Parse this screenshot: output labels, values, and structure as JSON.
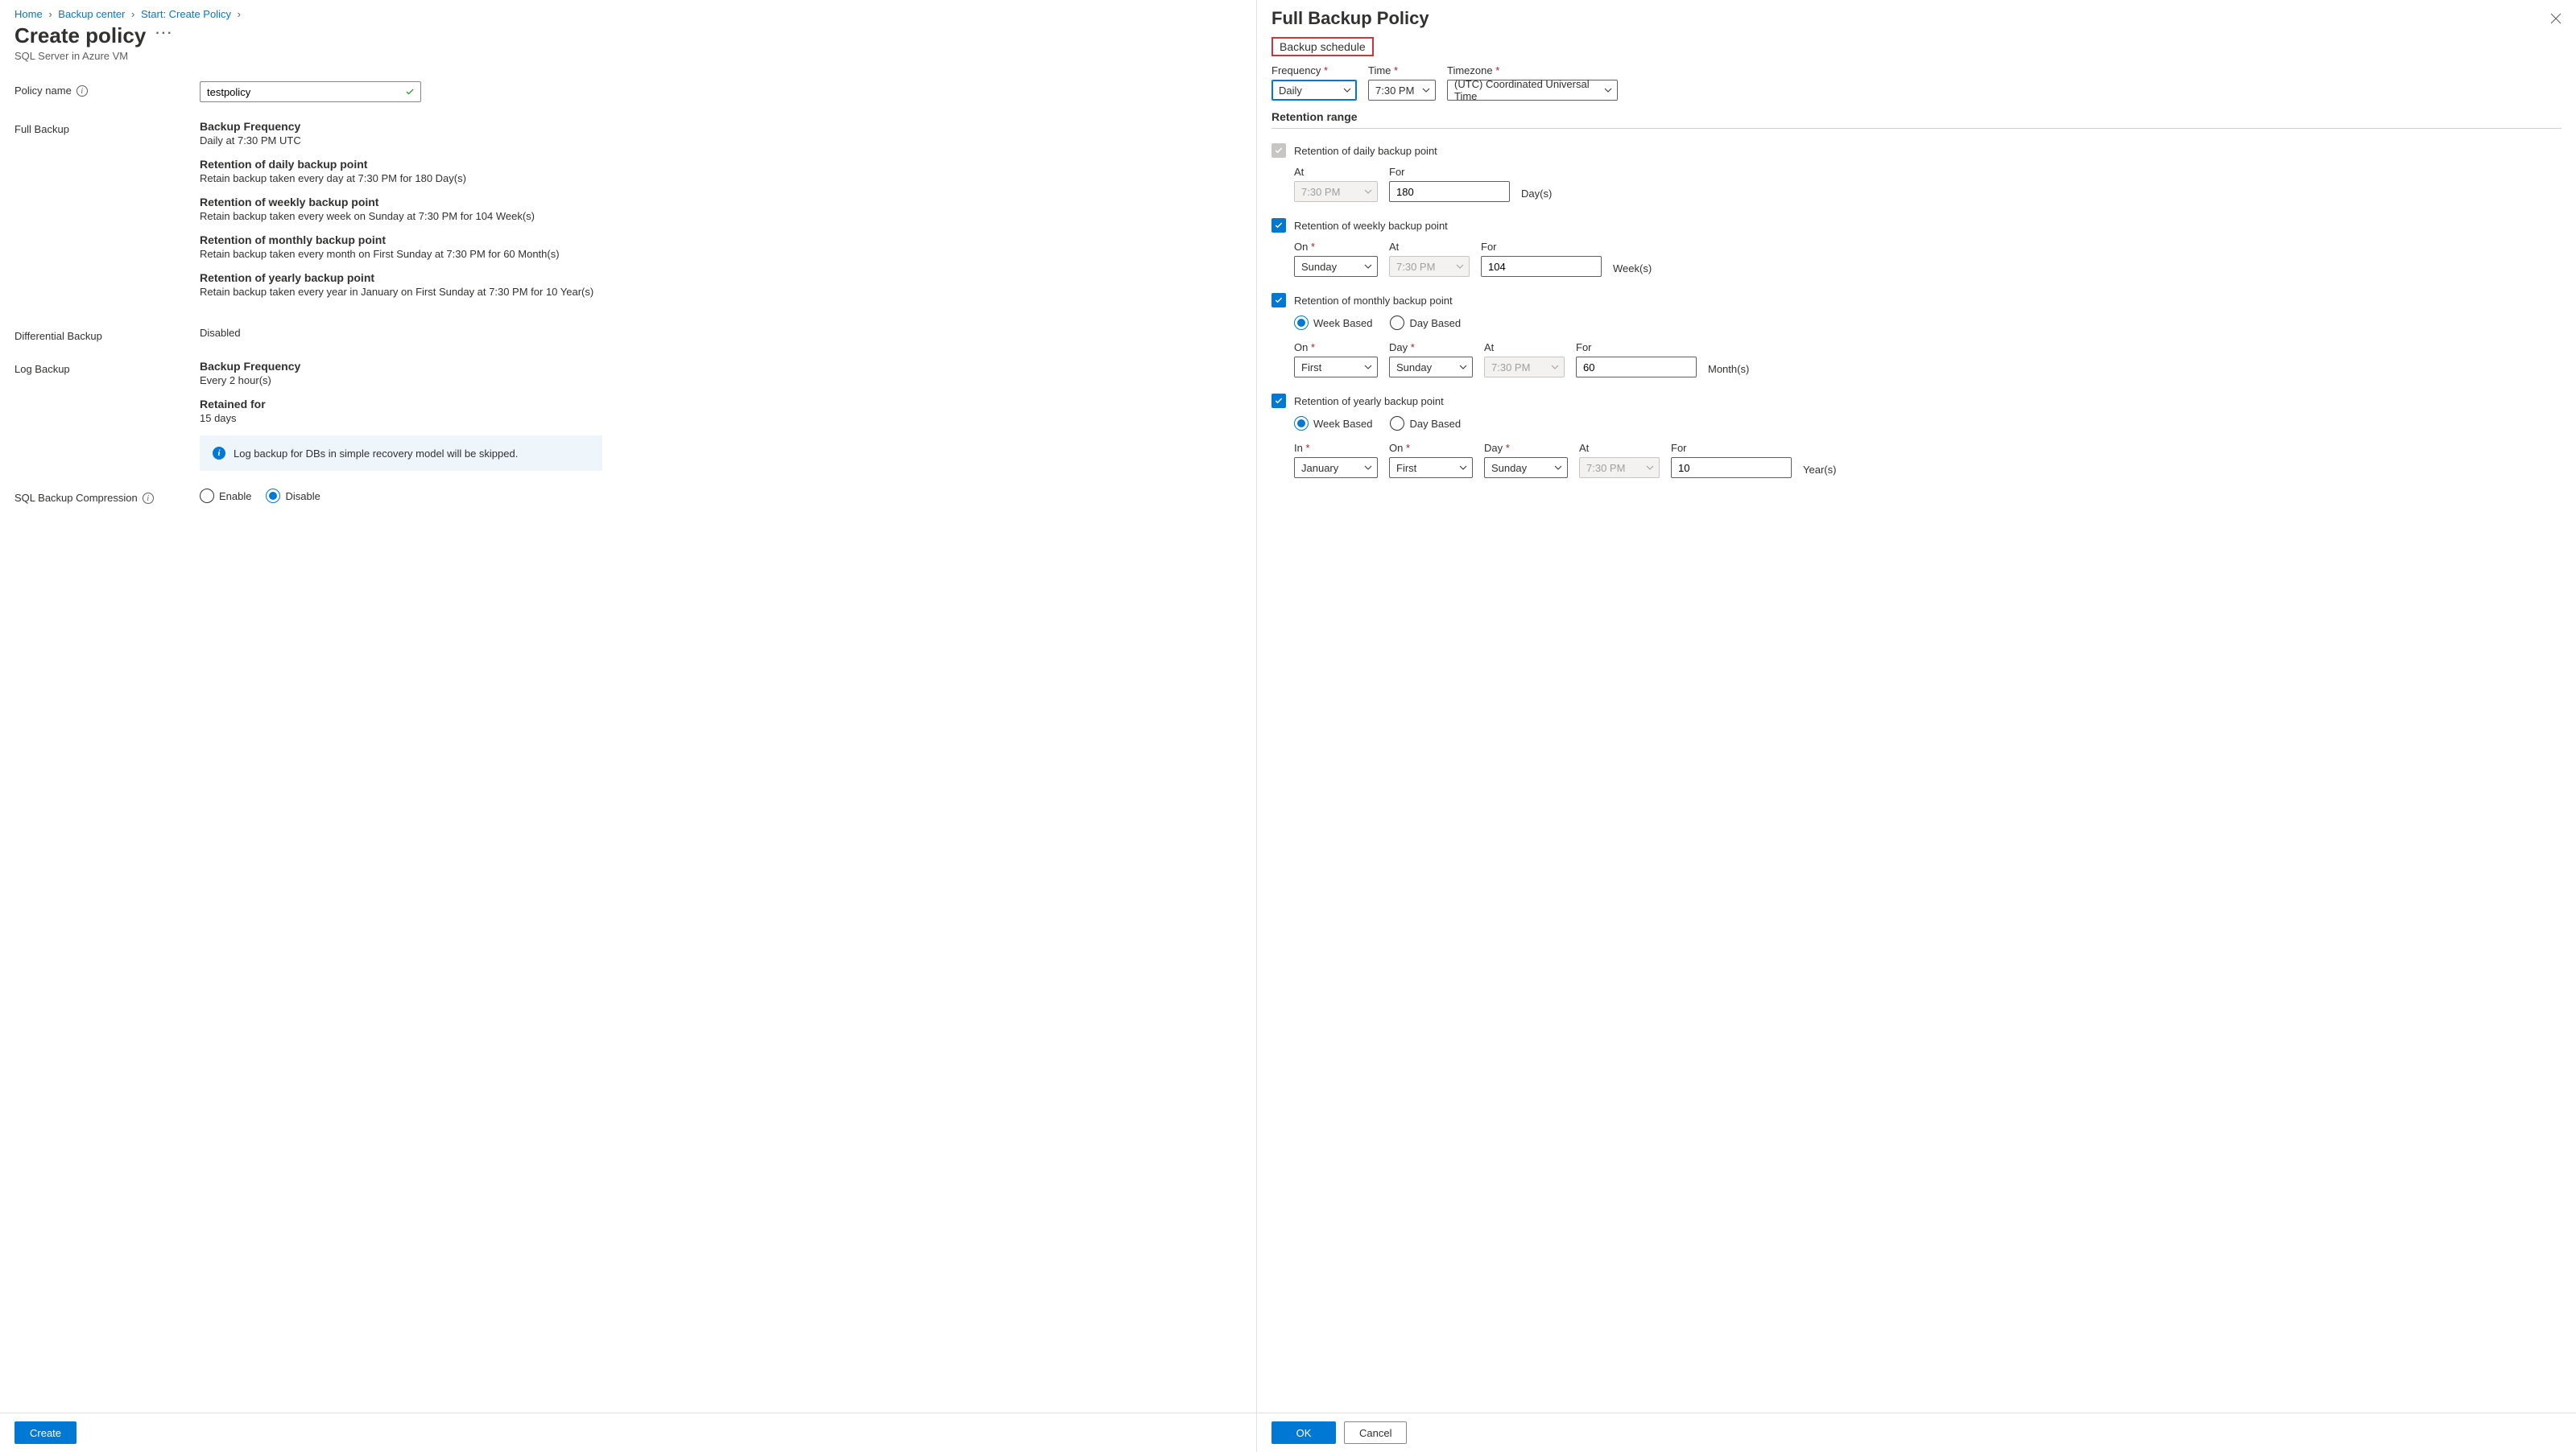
{
  "breadcrumb": {
    "home": "Home",
    "center": "Backup center",
    "create": "Start: Create Policy"
  },
  "left": {
    "title": "Create policy",
    "subtitle": "SQL Server in Azure VM",
    "policy_name_label": "Policy name",
    "policy_name_value": "testpolicy",
    "full_backup_label": "Full Backup",
    "fb": {
      "freq_h": "Backup Frequency",
      "freq_d": "Daily at 7:30 PM UTC",
      "daily_h": "Retention of daily backup point",
      "daily_d": "Retain backup taken every day at 7:30 PM for 180 Day(s)",
      "weekly_h": "Retention of weekly backup point",
      "weekly_d": "Retain backup taken every week on Sunday at 7:30 PM for 104 Week(s)",
      "monthly_h": "Retention of monthly backup point",
      "monthly_d": "Retain backup taken every month on First Sunday at 7:30 PM for 60 Month(s)",
      "yearly_h": "Retention of yearly backup point",
      "yearly_d": "Retain backup taken every year in January on First Sunday at 7:30 PM for 10 Year(s)"
    },
    "diff_label": "Differential Backup",
    "diff_val": "Disabled",
    "log_label": "Log Backup",
    "log": {
      "freq_h": "Backup Frequency",
      "freq_d": "Every 2 hour(s)",
      "ret_h": "Retained for",
      "ret_d": "15 days",
      "info": "Log backup for DBs in simple recovery model will be skipped."
    },
    "compress_label": "SQL Backup Compression",
    "enable": "Enable",
    "disable": "Disable",
    "create_btn": "Create"
  },
  "right": {
    "title": "Full Backup Policy",
    "schedule_label": "Backup schedule",
    "freq_label": "Frequency",
    "freq_val": "Daily",
    "time_label": "Time",
    "time_val": "7:30 PM",
    "tz_label": "Timezone",
    "tz_val": "(UTC) Coordinated Universal Time",
    "retention_label": "Retention range",
    "daily": {
      "label": "Retention of daily backup point",
      "at_l": "At",
      "at_v": "7:30 PM",
      "for_l": "For",
      "for_v": "180",
      "unit": "Day(s)"
    },
    "weekly": {
      "label": "Retention of weekly backup point",
      "on_l": "On",
      "on_v": "Sunday",
      "at_l": "At",
      "at_v": "7:30 PM",
      "for_l": "For",
      "for_v": "104",
      "unit": "Week(s)"
    },
    "monthly": {
      "label": "Retention of monthly backup point",
      "week_based": "Week Based",
      "day_based": "Day Based",
      "on_l": "On",
      "on_v": "First",
      "day_l": "Day",
      "day_v": "Sunday",
      "at_l": "At",
      "at_v": "7:30 PM",
      "for_l": "For",
      "for_v": "60",
      "unit": "Month(s)"
    },
    "yearly": {
      "label": "Retention of yearly backup point",
      "week_based": "Week Based",
      "day_based": "Day Based",
      "in_l": "In",
      "in_v": "January",
      "on_l": "On",
      "on_v": "First",
      "day_l": "Day",
      "day_v": "Sunday",
      "at_l": "At",
      "at_v": "7:30 PM",
      "for_l": "For",
      "for_v": "10",
      "unit": "Year(s)"
    },
    "ok_btn": "OK",
    "cancel_btn": "Cancel"
  }
}
